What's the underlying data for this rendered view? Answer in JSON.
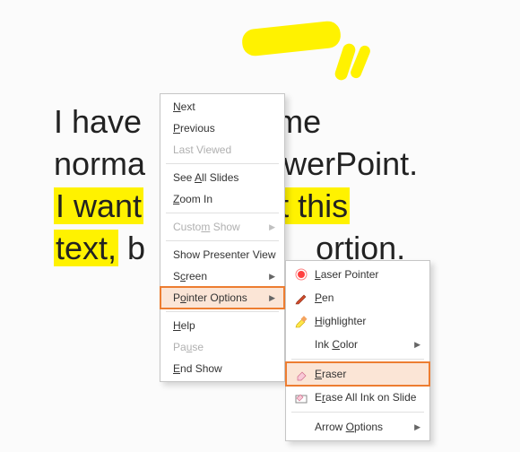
{
  "slide": {
    "line1a": "I have ",
    "line1b": "ome",
    "line2a": "norma",
    "line2b": "PowerPoint.",
    "line3a": "I want",
    "line3b": "ght this",
    "line4a": "text,",
    "line4b": " b",
    "line4c": "ortion."
  },
  "menu1": {
    "next": "Next",
    "previous": "Previous",
    "last_viewed": "Last Viewed",
    "see_all_slides": "See All Slides",
    "zoom_in": "Zoom In",
    "custom_show": "Custom Show",
    "show_presenter": "Show Presenter View",
    "screen": "Screen",
    "pointer_options": "Pointer Options",
    "help": "Help",
    "pause": "Pause",
    "end_show": "End Show"
  },
  "menu2": {
    "laser_pointer": "Laser Pointer",
    "pen": "Pen",
    "highlighter": "Highlighter",
    "ink_color": "Ink Color",
    "eraser": "Eraser",
    "erase_all": "Erase All Ink on Slide",
    "arrow_options": "Arrow Options"
  }
}
